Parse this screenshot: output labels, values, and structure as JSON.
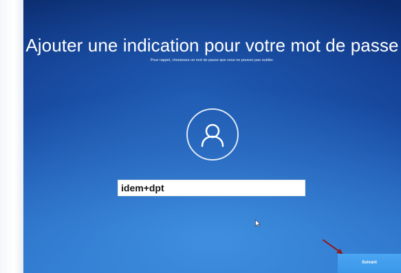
{
  "setup": {
    "title": "Ajouter une indication pour votre mot de passe",
    "subtitle": "Pour rappel, choisissez un mot de passe que vous ne pouvez pas oublier.",
    "hint_value": "idem+dpt",
    "next_label": "Suivant"
  },
  "icons": {
    "avatar": "user-icon",
    "pointer": "mouse-pointer-icon",
    "annotation": "red-arrow-icon"
  },
  "colors": {
    "background_top": "#0b2b6d",
    "background_bottom": "#2a72c8",
    "button": "#3a96e8",
    "annotation_arrow": "#8a1f24"
  }
}
